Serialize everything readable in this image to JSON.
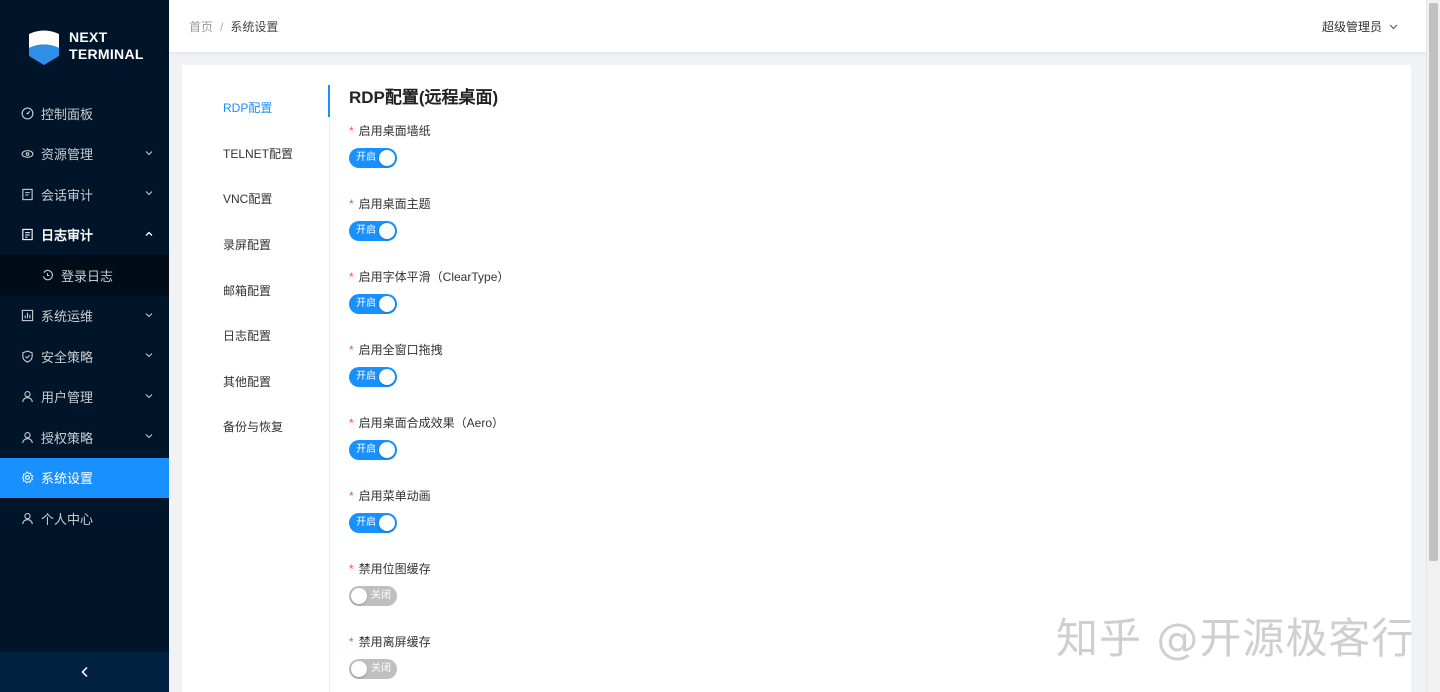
{
  "app": {
    "logo_line1": "NEXT",
    "logo_line2": "TERMINAL",
    "brand_color": "#1890ff"
  },
  "sidebar": {
    "items": [
      {
        "label": "控制面板",
        "icon": "dashboard-icon"
      },
      {
        "label": "资源管理",
        "icon": "cloud-icon"
      },
      {
        "label": "会话审计",
        "icon": "audit-icon"
      },
      {
        "label": "日志审计",
        "icon": "log-icon"
      },
      {
        "label": "登录日志",
        "icon": "login-log-icon"
      },
      {
        "label": "系统运维",
        "icon": "ops-icon"
      },
      {
        "label": "安全策略",
        "icon": "shield-icon"
      },
      {
        "label": "用户管理",
        "icon": "user-icon"
      },
      {
        "label": "授权策略",
        "icon": "auth-icon"
      },
      {
        "label": "系统设置",
        "icon": "gear-icon"
      },
      {
        "label": "个人中心",
        "icon": "person-icon"
      }
    ],
    "collapse_icon": "chevron-left-icon"
  },
  "header": {
    "breadcrumb_home": "首页",
    "breadcrumb_sep": "/",
    "breadcrumb_current": "系统设置",
    "user_name": "超级管理员"
  },
  "settings": {
    "tabs": [
      "RDP配置",
      "TELNET配置",
      "VNC配置",
      "录屏配置",
      "邮箱配置",
      "日志配置",
      "其他配置",
      "备份与恢复"
    ],
    "active_tab": "RDP配置",
    "panel_title": "RDP配置(远程桌面)",
    "items": [
      {
        "label": "启用桌面墙纸",
        "state": "开启",
        "on": true
      },
      {
        "label": "启用桌面主题",
        "state": "开启",
        "on": true
      },
      {
        "label": "启用字体平滑（ClearType）",
        "state": "开启",
        "on": true
      },
      {
        "label": "启用全窗口拖拽",
        "state": "开启",
        "on": true
      },
      {
        "label": "启用桌面合成效果（Aero）",
        "state": "开启",
        "on": true
      },
      {
        "label": "启用菜单动画",
        "state": "开启",
        "on": true
      },
      {
        "label": "禁用位图缓存",
        "state": "关闭",
        "on": false
      },
      {
        "label": "禁用离屏缓存",
        "state": "关闭",
        "on": false
      }
    ],
    "required_mark": "*"
  },
  "watermark": "知乎 @开源极客行"
}
